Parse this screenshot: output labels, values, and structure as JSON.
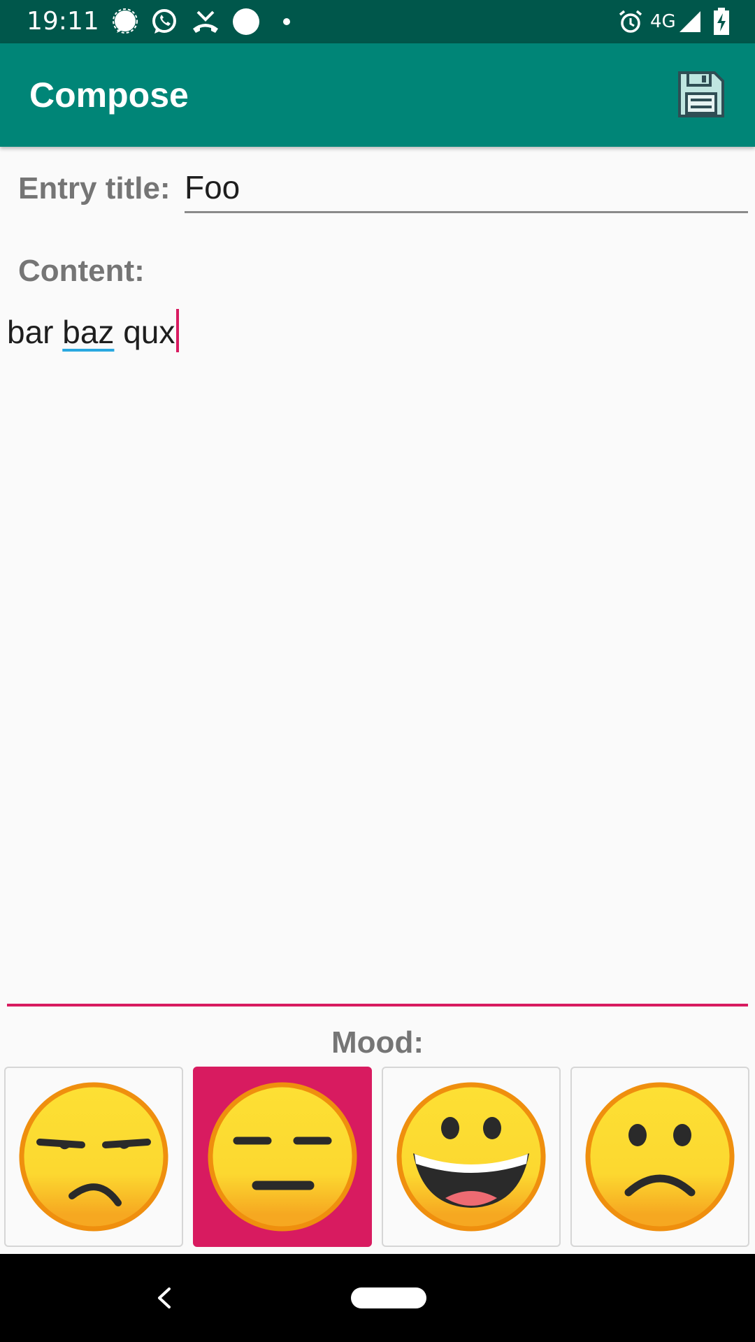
{
  "status_bar": {
    "time": "19:11",
    "network": "4G",
    "icons": [
      "signal-messenger-icon",
      "whatsapp-icon",
      "missed-call-icon",
      "circle-notification-icon",
      "dot-icon",
      "alarm-icon",
      "cell-signal-icon",
      "battery-charging-icon"
    ]
  },
  "app_bar": {
    "title": "Compose",
    "save_icon": "floppy-disk-save-icon"
  },
  "form": {
    "entry_title_label": "Entry title:",
    "entry_title_value": "Foo",
    "content_label": "Content:",
    "content_parts": [
      "bar ",
      "baz",
      " qux"
    ],
    "mood_label": "Mood:"
  },
  "moods": [
    {
      "name": "unamused-face-icon",
      "selected": false
    },
    {
      "name": "expressionless-face-icon",
      "selected": true
    },
    {
      "name": "grinning-face-icon",
      "selected": false
    },
    {
      "name": "frowning-face-icon",
      "selected": false
    }
  ],
  "colors": {
    "status_bar": "#00574b",
    "app_bar": "#008577",
    "accent": "#d81b60"
  }
}
